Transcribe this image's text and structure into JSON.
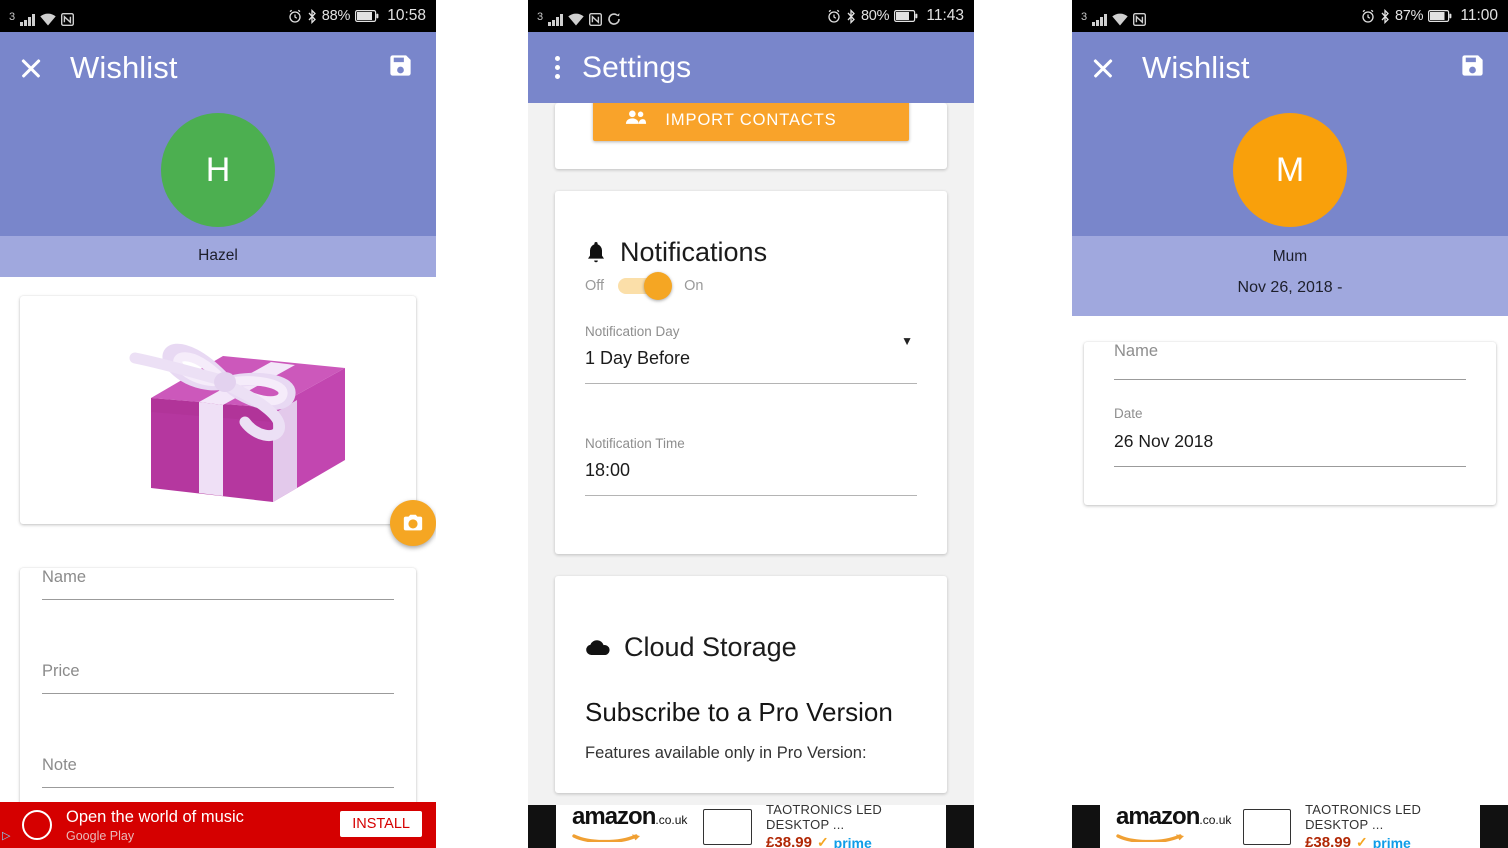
{
  "panels": [
    {
      "id": "wishlist-hazel",
      "status_bar": {
        "carrier": "3",
        "icons": [
          "signal-icon",
          "wifi-icon",
          "nfc-icon"
        ],
        "right_icons": [
          "alarm-icon",
          "bluetooth-icon"
        ],
        "battery_pct": "88%",
        "time": "10:58"
      },
      "appbar": {
        "close_icon": "close-icon",
        "title": "Wishlist",
        "save_icon": "save-icon"
      },
      "hero": {
        "avatar_letter": "H",
        "avatar_color": "#4caf50",
        "name": "Hazel"
      },
      "photo": {
        "alt": "gift-box-image",
        "camera_button": "camera-icon"
      },
      "fields": [
        {
          "label": "Name",
          "value": ""
        },
        {
          "label": "Price",
          "value": ""
        },
        {
          "label": "Note",
          "value": ""
        }
      ],
      "ad": {
        "type": "google-play",
        "headline": "Open the world of music",
        "source": "Google Play",
        "cta": "INSTALL"
      }
    },
    {
      "id": "settings",
      "status_bar": {
        "carrier": "3",
        "icons": [
          "signal-icon",
          "wifi-icon",
          "nfc-icon",
          "sync-icon"
        ],
        "right_icons": [
          "alarm-icon",
          "bluetooth-icon"
        ],
        "battery_pct": "80%",
        "time": "11:43"
      },
      "appbar": {
        "menu_icon": "more-vert-icon",
        "title": "Settings"
      },
      "import_button": {
        "label": "IMPORT CONTACTS",
        "icon": "people-icon",
        "color": "#f9a32a"
      },
      "notifications": {
        "icon": "bell-icon",
        "title": "Notifications",
        "toggle_off_label": "Off",
        "toggle_on_label": "On",
        "toggle_state": "on",
        "day_label": "Notification Day",
        "day_value": "1 Day Before",
        "time_label": "Notification Time",
        "time_value": "18:00"
      },
      "cloud": {
        "icon": "cloud-icon",
        "title": "Cloud Storage",
        "pro_title": "Subscribe to a Pro Version",
        "pro_sub": "Features available only in Pro Version:"
      },
      "ad": {
        "type": "amazon",
        "logo": "amazon",
        "domain": ".co.uk",
        "item": "TAOTRONICS LED DESKTOP ...",
        "price": "£38.99",
        "prime": "prime"
      }
    },
    {
      "id": "wishlist-mum",
      "status_bar": {
        "carrier": "3",
        "icons": [
          "signal-icon",
          "wifi-icon",
          "nfc-icon"
        ],
        "right_icons": [
          "alarm-icon",
          "bluetooth-icon"
        ],
        "battery_pct": "87%",
        "time": "11:00"
      },
      "appbar": {
        "close_icon": "close-icon",
        "title": "Wishlist",
        "save_icon": "save-icon"
      },
      "hero": {
        "avatar_letter": "M",
        "avatar_color": "#f9a00b",
        "name": "Mum",
        "date_line": "Nov 26, 2018 -"
      },
      "fields": [
        {
          "label": "Name",
          "value": ""
        },
        {
          "label": "Date",
          "value": "26 Nov 2018"
        }
      ],
      "ad": {
        "type": "amazon",
        "logo": "amazon",
        "domain": ".co.uk",
        "item": "TAOTRONICS LED DESKTOP ...",
        "price": "£38.99",
        "prime": "prime"
      }
    }
  ],
  "theme": {
    "appbar_purple": "#7986cb",
    "namestrip_purple": "#a0a8de",
    "accent_orange": "#f5a623",
    "ad_red": "#d50000"
  }
}
